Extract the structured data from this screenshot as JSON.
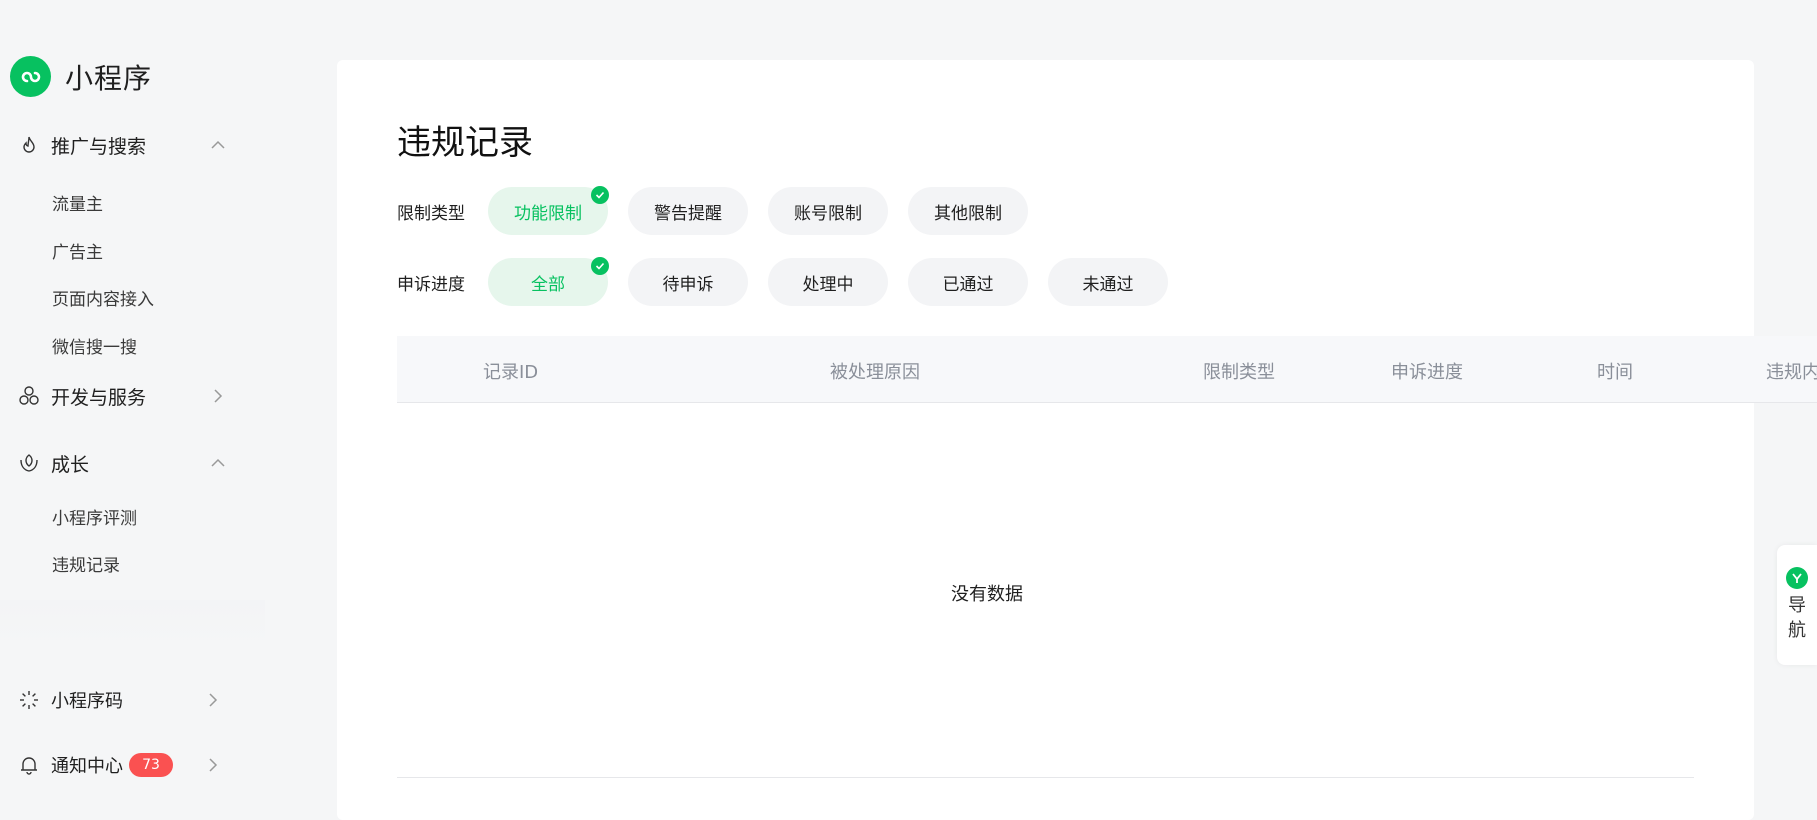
{
  "brand": {
    "title": "小程序"
  },
  "sidebar": {
    "groups": [
      {
        "label": "推广与搜索",
        "icon": "flame-icon",
        "expanded": true,
        "items": [
          "流量主",
          "广告主",
          "页面内容接入",
          "微信搜一搜"
        ]
      },
      {
        "label": "开发与服务",
        "icon": "hexagon-cluster-icon",
        "expanded": false
      },
      {
        "label": "成长",
        "icon": "leaf-hand-icon",
        "expanded": true,
        "items": [
          "小程序评测",
          "违规记录"
        ]
      }
    ],
    "bottom": [
      {
        "label": "小程序码",
        "icon": "sunburst-icon"
      },
      {
        "label": "通知中心",
        "icon": "bell-icon",
        "badge": "73"
      }
    ]
  },
  "main": {
    "title": "违规记录",
    "filters": {
      "restriction": {
        "label": "限制类型",
        "options": [
          "功能限制",
          "警告提醒",
          "账号限制",
          "其他限制"
        ],
        "selected": "功能限制"
      },
      "appeal": {
        "label": "申诉进度",
        "options": [
          "全部",
          "待申诉",
          "处理中",
          "已通过",
          "未通过"
        ],
        "selected": "全部"
      }
    },
    "table": {
      "columns": [
        "记录ID",
        "被处理原因",
        "限制类型",
        "申诉进度",
        "时间",
        "违规内"
      ],
      "empty_text": "没有数据"
    }
  },
  "float_nav": {
    "label": "导航"
  },
  "colors": {
    "accent": "#07c160",
    "badge": "#fa5151",
    "background": "#f5f6f7"
  }
}
